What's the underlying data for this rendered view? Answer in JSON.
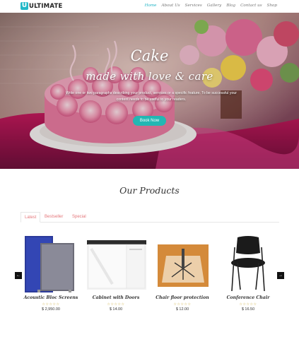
{
  "header": {
    "logo_mark": "U",
    "logo_text": "ULTIMATE",
    "nav": [
      "Home",
      "About Us",
      "Services",
      "Gallery",
      "Blog",
      "Contact us",
      "Shop"
    ],
    "active_nav": "Home"
  },
  "hero": {
    "title": "Cake",
    "subtitle": "made with love & care",
    "description": "Write one or two paragraphs describing your product, services or a specific feature.  To be successful your content needs to be useful to your readers.",
    "button": "Book Now"
  },
  "products_section": {
    "title": "Our Products",
    "tabs": [
      "Latest",
      "Bestseller",
      "Special"
    ],
    "active_tab": "Latest",
    "items": [
      {
        "name": "Acoustic Bloc Screens",
        "stars": "☆☆☆☆☆",
        "price": "$ 2,950.00",
        "image": "screen-panels-image"
      },
      {
        "name": "Cabinet with Doors",
        "stars": "☆☆☆☆☆",
        "price": "$ 14.00",
        "image": "cabinet-image"
      },
      {
        "name": "Chair floor protection",
        "stars": "☆☆☆☆☆",
        "price": "$ 12.00",
        "image": "floor-mat-image"
      },
      {
        "name": "Conference Chair",
        "stars": "☆☆☆☆☆",
        "price": "$ 16.50",
        "image": "chair-image"
      }
    ]
  },
  "carousel": {
    "prev_icon": "←",
    "next_icon": "→"
  },
  "colors": {
    "accent": "#1fb3c5",
    "button": "#22b7b3",
    "tab_text": "#e4767a"
  }
}
